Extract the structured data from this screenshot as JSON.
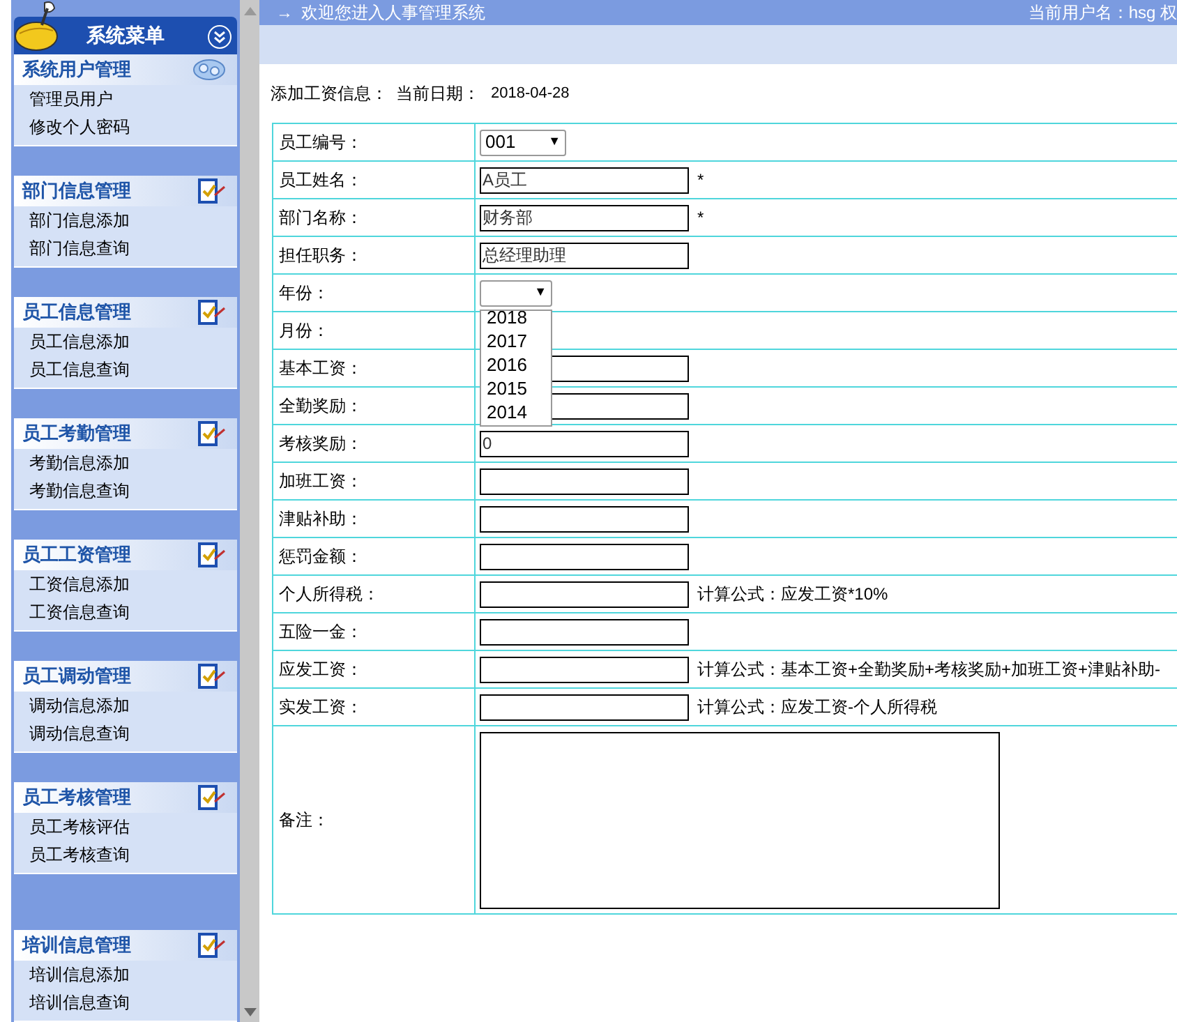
{
  "sidebar": {
    "title": "系统菜单",
    "groups": [
      {
        "title": "系统用户管理",
        "kind": "globe",
        "items": [
          "管理员用户",
          "修改个人密码"
        ]
      },
      {
        "title": "部门信息管理",
        "kind": "edit",
        "items": [
          "部门信息添加",
          "部门信息查询"
        ]
      },
      {
        "title": "员工信息管理",
        "kind": "edit",
        "items": [
          "员工信息添加",
          "员工信息查询"
        ]
      },
      {
        "title": "员工考勤管理",
        "kind": "edit",
        "items": [
          "考勤信息添加",
          "考勤信息查询"
        ]
      },
      {
        "title": "员工工资管理",
        "kind": "edit",
        "items": [
          "工资信息添加",
          "工资信息查询"
        ]
      },
      {
        "title": "员工调动管理",
        "kind": "edit",
        "items": [
          "调动信息添加",
          "调动信息查询"
        ]
      },
      {
        "title": "员工考核管理",
        "kind": "edit",
        "items": [
          "员工考核评估",
          "员工考核查询"
        ]
      },
      {
        "title": "培训信息管理",
        "kind": "edit",
        "items": [
          "培训信息添加",
          "培训信息查询"
        ]
      }
    ]
  },
  "top_bar": {
    "arrow": "→",
    "welcome": "欢迎您进入人事管理系统",
    "user": "当前用户名：hsg 权"
  },
  "form": {
    "title": "添加工资信息：",
    "date_label": "当前日期：",
    "date": "2018-04-28",
    "rows": [
      {
        "label": "员工编号：",
        "kind": "select",
        "value": "001",
        "caret": "▼"
      },
      {
        "label": "员工姓名：",
        "kind": "text",
        "value": "A员工",
        "mark": "*"
      },
      {
        "label": "部门名称：",
        "kind": "text",
        "value": "财务部",
        "mark": "*"
      },
      {
        "label": "担任职务：",
        "kind": "text",
        "value": "总经理助理"
      },
      {
        "label": "年份：",
        "kind": "select",
        "caret": "▼",
        "open": true,
        "options": [
          "2018",
          "2017",
          "2016",
          "2015",
          "2014"
        ]
      },
      {
        "label": "月份：",
        "kind": "none"
      },
      {
        "label": "基本工资：",
        "kind": "text"
      },
      {
        "label": "全勤奖励：",
        "kind": "text"
      },
      {
        "label": "考核奖励：",
        "kind": "text",
        "value": "0"
      },
      {
        "label": "加班工资：",
        "kind": "text"
      },
      {
        "label": "津贴补助：",
        "kind": "text"
      },
      {
        "label": "惩罚金额：",
        "kind": "text"
      },
      {
        "label": "个人所得税：",
        "kind": "text",
        "note": "计算公式：应发工资*10%"
      },
      {
        "label": "五险一金：",
        "kind": "text"
      },
      {
        "label": "应发工资：",
        "kind": "text",
        "note": "计算公式：基本工资+全勤奖励+考核奖励+加班工资+津贴补助-"
      },
      {
        "label": "实发工资：",
        "kind": "text",
        "note": "计算公式：应发工资-个人所得税"
      },
      {
        "label": "备注：",
        "kind": "textarea"
      }
    ]
  }
}
